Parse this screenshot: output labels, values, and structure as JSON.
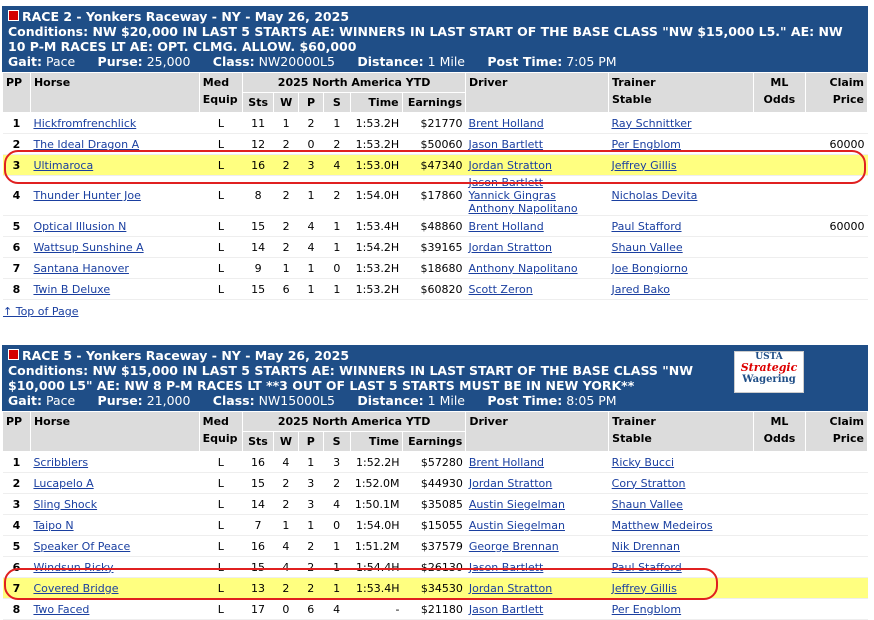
{
  "columns": {
    "pp": "PP",
    "horse": "Horse",
    "med": "Med",
    "equip": "Equip",
    "ytd": "2025 North America YTD",
    "sts": "Sts",
    "w": "W",
    "p": "P",
    "s": "S",
    "time": "Time",
    "earnings": "Earnings",
    "driver": "Driver",
    "trainer": "Trainer",
    "stable": "Stable",
    "ml": "ML",
    "odds": "Odds",
    "claim": "Claim",
    "price": "Price"
  },
  "race2": {
    "title": "RACE 2 - Yonkers Raceway - NY - May 26, 2025",
    "conditions_label": "Conditions:",
    "conditions": "NW $20,000 IN LAST 5 STARTS AE: WINNERS IN LAST START OF THE BASE CLASS \"NW $15,000 L5.\" AE: NW 10 P-M RACES LT AE: OPT. CLMG. ALLOW. $60,000",
    "gait_label": "Gait:",
    "gait": "Pace",
    "purse_label": "Purse:",
    "purse": "25,000",
    "class_label": "Class:",
    "class": "NW20000L5",
    "distance_label": "Distance:",
    "distance": "1 Mile",
    "post_label": "Post Time:",
    "post": "7:05 PM",
    "rows": [
      {
        "pp": "1",
        "horse": "Hickfromfrenchlick",
        "med": "L",
        "sts": "11",
        "w": "1",
        "p": "2",
        "s": "1",
        "time": "1:53.2H",
        "earn": "$21770",
        "driver": "Brent Holland",
        "trainer": "Ray Schnittker",
        "claim": ""
      },
      {
        "pp": "2",
        "horse": "The Ideal Dragon A",
        "med": "L",
        "sts": "12",
        "w": "2",
        "p": "0",
        "s": "2",
        "time": "1:53.2H",
        "earn": "$50060",
        "driver": "Jason Bartlett",
        "trainer": "Per Engblom",
        "claim": "60000"
      },
      {
        "pp": "3",
        "horse": "Ultimaroca",
        "med": "L",
        "sts": "16",
        "w": "2",
        "p": "3",
        "s": "4",
        "time": "1:53.0H",
        "earn": "$47340",
        "driver": "Jordan Stratton",
        "trainer": "Jeffrey Gillis",
        "claim": ""
      },
      {
        "pp": "4",
        "horse": "Thunder Hunter Joe",
        "med": "L",
        "sts": "8",
        "w": "2",
        "p": "1",
        "s": "2",
        "time": "1:54.0H",
        "earn": "$17860",
        "driver": "Jason Bartlett",
        "driver2": "Yannick Gingras",
        "driver3": "Anthony Napolitano",
        "trainer": "Nicholas Devita",
        "claim": ""
      },
      {
        "pp": "5",
        "horse": "Optical Illusion N",
        "med": "L",
        "sts": "15",
        "w": "2",
        "p": "4",
        "s": "1",
        "time": "1:53.4H",
        "earn": "$48860",
        "driver": "Brent Holland",
        "trainer": "Paul Stafford",
        "claim": "60000"
      },
      {
        "pp": "6",
        "horse": "Wattsup Sunshine A",
        "med": "L",
        "sts": "14",
        "w": "2",
        "p": "4",
        "s": "1",
        "time": "1:54.2H",
        "earn": "$39165",
        "driver": "Jordan Stratton",
        "trainer": "Shaun Vallee",
        "claim": ""
      },
      {
        "pp": "7",
        "horse": "Santana Hanover",
        "med": "L",
        "sts": "9",
        "w": "1",
        "p": "1",
        "s": "0",
        "time": "1:53.2H",
        "earn": "$18680",
        "driver": "Anthony Napolitano",
        "trainer": "Joe Bongiorno",
        "claim": ""
      },
      {
        "pp": "8",
        "horse": "Twin B Deluxe",
        "med": "L",
        "sts": "15",
        "w": "6",
        "p": "1",
        "s": "1",
        "time": "1:53.2H",
        "earn": "$60820",
        "driver": "Scott Zeron",
        "trainer": "Jared Bako",
        "claim": ""
      }
    ]
  },
  "top_of_page": "↑ Top of Page",
  "race5": {
    "title": "RACE 5 - Yonkers Raceway - NY - May 26, 2025",
    "conditions_label": "Conditions:",
    "conditions": "NW $15,000 IN LAST 5 STARTS AE: WINNERS IN LAST START OF THE BASE CLASS \"NW $10,000 L5\" AE: NW 8 P-M RACES LT **3 OUT OF LAST 5 STARTS MUST BE IN NEW YORK**",
    "gait_label": "Gait:",
    "gait": "Pace",
    "purse_label": "Purse:",
    "purse": "21,000",
    "class_label": "Class:",
    "class": "NW15000L5",
    "distance_label": "Distance:",
    "distance": "1 Mile",
    "post_label": "Post Time:",
    "post": "8:05 PM",
    "logo": {
      "l1": "USTA",
      "l2": "Strategic",
      "l3": "Wagering"
    },
    "rows": [
      {
        "pp": "1",
        "horse": "Scribblers",
        "med": "L",
        "sts": "16",
        "w": "4",
        "p": "1",
        "s": "3",
        "time": "1:52.2H",
        "earn": "$57280",
        "driver": "Brent Holland",
        "trainer": "Ricky Bucci",
        "claim": ""
      },
      {
        "pp": "2",
        "horse": "Lucapelo A",
        "med": "L",
        "sts": "15",
        "w": "2",
        "p": "3",
        "s": "2",
        "time": "1:52.0M",
        "earn": "$44930",
        "driver": "Jordan Stratton",
        "trainer": "Cory Stratton",
        "claim": ""
      },
      {
        "pp": "3",
        "horse": "Sling Shock",
        "med": "L",
        "sts": "14",
        "w": "2",
        "p": "3",
        "s": "4",
        "time": "1:50.1M",
        "earn": "$35085",
        "driver": "Austin Siegelman",
        "trainer": "Shaun Vallee",
        "claim": ""
      },
      {
        "pp": "4",
        "horse": "Taipo N",
        "med": "L",
        "sts": "7",
        "w": "1",
        "p": "1",
        "s": "0",
        "time": "1:54.0H",
        "earn": "$15055",
        "driver": "Austin Siegelman",
        "trainer": "Matthew Medeiros",
        "claim": ""
      },
      {
        "pp": "5",
        "horse": "Speaker Of Peace",
        "med": "L",
        "sts": "16",
        "w": "4",
        "p": "2",
        "s": "1",
        "time": "1:51.2M",
        "earn": "$37579",
        "driver": "George Brennan",
        "trainer": "Nik Drennan",
        "claim": ""
      },
      {
        "pp": "6",
        "horse": "Windsun Ricky",
        "med": "L",
        "sts": "15",
        "w": "4",
        "p": "2",
        "s": "1",
        "time": "1:54.4H",
        "earn": "$26130",
        "driver": "Jason Bartlett",
        "trainer": "Paul Stafford",
        "claim": ""
      },
      {
        "pp": "7",
        "horse": "Covered Bridge",
        "med": "L",
        "sts": "13",
        "w": "2",
        "p": "2",
        "s": "1",
        "time": "1:53.4H",
        "earn": "$34530",
        "driver": "Jordan Stratton",
        "trainer": "Jeffrey Gillis",
        "claim": ""
      },
      {
        "pp": "8",
        "horse": "Two Faced",
        "med": "L",
        "sts": "17",
        "w": "0",
        "p": "6",
        "s": "4",
        "time": "-",
        "earn": "$21180",
        "driver": "Jason Bartlett",
        "trainer": "Per Engblom",
        "claim": ""
      }
    ]
  }
}
